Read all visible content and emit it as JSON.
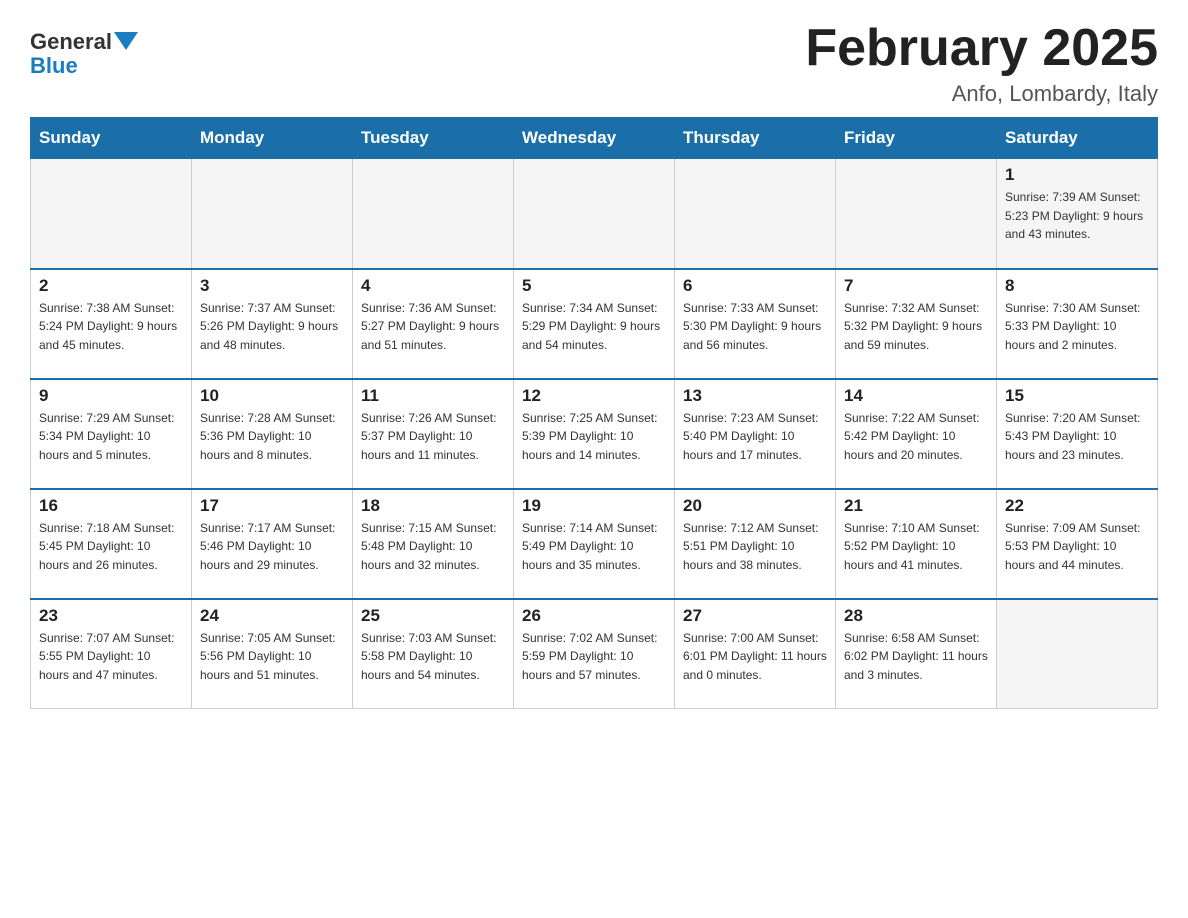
{
  "header": {
    "logo_general": "General",
    "logo_blue": "Blue",
    "title": "February 2025",
    "location": "Anfo, Lombardy, Italy"
  },
  "days_of_week": [
    "Sunday",
    "Monday",
    "Tuesday",
    "Wednesday",
    "Thursday",
    "Friday",
    "Saturday"
  ],
  "weeks": [
    [
      {
        "day": "",
        "info": ""
      },
      {
        "day": "",
        "info": ""
      },
      {
        "day": "",
        "info": ""
      },
      {
        "day": "",
        "info": ""
      },
      {
        "day": "",
        "info": ""
      },
      {
        "day": "",
        "info": ""
      },
      {
        "day": "1",
        "info": "Sunrise: 7:39 AM\nSunset: 5:23 PM\nDaylight: 9 hours\nand 43 minutes."
      }
    ],
    [
      {
        "day": "2",
        "info": "Sunrise: 7:38 AM\nSunset: 5:24 PM\nDaylight: 9 hours\nand 45 minutes."
      },
      {
        "day": "3",
        "info": "Sunrise: 7:37 AM\nSunset: 5:26 PM\nDaylight: 9 hours\nand 48 minutes."
      },
      {
        "day": "4",
        "info": "Sunrise: 7:36 AM\nSunset: 5:27 PM\nDaylight: 9 hours\nand 51 minutes."
      },
      {
        "day": "5",
        "info": "Sunrise: 7:34 AM\nSunset: 5:29 PM\nDaylight: 9 hours\nand 54 minutes."
      },
      {
        "day": "6",
        "info": "Sunrise: 7:33 AM\nSunset: 5:30 PM\nDaylight: 9 hours\nand 56 minutes."
      },
      {
        "day": "7",
        "info": "Sunrise: 7:32 AM\nSunset: 5:32 PM\nDaylight: 9 hours\nand 59 minutes."
      },
      {
        "day": "8",
        "info": "Sunrise: 7:30 AM\nSunset: 5:33 PM\nDaylight: 10 hours\nand 2 minutes."
      }
    ],
    [
      {
        "day": "9",
        "info": "Sunrise: 7:29 AM\nSunset: 5:34 PM\nDaylight: 10 hours\nand 5 minutes."
      },
      {
        "day": "10",
        "info": "Sunrise: 7:28 AM\nSunset: 5:36 PM\nDaylight: 10 hours\nand 8 minutes."
      },
      {
        "day": "11",
        "info": "Sunrise: 7:26 AM\nSunset: 5:37 PM\nDaylight: 10 hours\nand 11 minutes."
      },
      {
        "day": "12",
        "info": "Sunrise: 7:25 AM\nSunset: 5:39 PM\nDaylight: 10 hours\nand 14 minutes."
      },
      {
        "day": "13",
        "info": "Sunrise: 7:23 AM\nSunset: 5:40 PM\nDaylight: 10 hours\nand 17 minutes."
      },
      {
        "day": "14",
        "info": "Sunrise: 7:22 AM\nSunset: 5:42 PM\nDaylight: 10 hours\nand 20 minutes."
      },
      {
        "day": "15",
        "info": "Sunrise: 7:20 AM\nSunset: 5:43 PM\nDaylight: 10 hours\nand 23 minutes."
      }
    ],
    [
      {
        "day": "16",
        "info": "Sunrise: 7:18 AM\nSunset: 5:45 PM\nDaylight: 10 hours\nand 26 minutes."
      },
      {
        "day": "17",
        "info": "Sunrise: 7:17 AM\nSunset: 5:46 PM\nDaylight: 10 hours\nand 29 minutes."
      },
      {
        "day": "18",
        "info": "Sunrise: 7:15 AM\nSunset: 5:48 PM\nDaylight: 10 hours\nand 32 minutes."
      },
      {
        "day": "19",
        "info": "Sunrise: 7:14 AM\nSunset: 5:49 PM\nDaylight: 10 hours\nand 35 minutes."
      },
      {
        "day": "20",
        "info": "Sunrise: 7:12 AM\nSunset: 5:51 PM\nDaylight: 10 hours\nand 38 minutes."
      },
      {
        "day": "21",
        "info": "Sunrise: 7:10 AM\nSunset: 5:52 PM\nDaylight: 10 hours\nand 41 minutes."
      },
      {
        "day": "22",
        "info": "Sunrise: 7:09 AM\nSunset: 5:53 PM\nDaylight: 10 hours\nand 44 minutes."
      }
    ],
    [
      {
        "day": "23",
        "info": "Sunrise: 7:07 AM\nSunset: 5:55 PM\nDaylight: 10 hours\nand 47 minutes."
      },
      {
        "day": "24",
        "info": "Sunrise: 7:05 AM\nSunset: 5:56 PM\nDaylight: 10 hours\nand 51 minutes."
      },
      {
        "day": "25",
        "info": "Sunrise: 7:03 AM\nSunset: 5:58 PM\nDaylight: 10 hours\nand 54 minutes."
      },
      {
        "day": "26",
        "info": "Sunrise: 7:02 AM\nSunset: 5:59 PM\nDaylight: 10 hours\nand 57 minutes."
      },
      {
        "day": "27",
        "info": "Sunrise: 7:00 AM\nSunset: 6:01 PM\nDaylight: 11 hours\nand 0 minutes."
      },
      {
        "day": "28",
        "info": "Sunrise: 6:58 AM\nSunset: 6:02 PM\nDaylight: 11 hours\nand 3 minutes."
      },
      {
        "day": "",
        "info": ""
      }
    ]
  ]
}
